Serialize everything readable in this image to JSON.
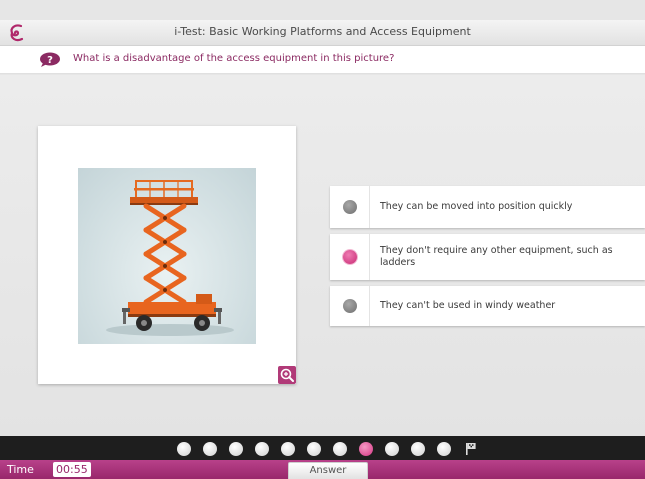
{
  "app": {
    "title": "i-Test: Basic Working Platforms and Access Equipment",
    "logo_icon": "swirl-logo-icon"
  },
  "question": {
    "icon": "question-bubble-icon",
    "text": "What is a disadvantage of the access equipment in this picture?"
  },
  "image": {
    "subject": "scissor-lift",
    "zoom_icon": "zoom-in-icon"
  },
  "options": [
    {
      "text": "They can be moved into position quickly",
      "selected": false
    },
    {
      "text": "They don't require any other equipment, such as ladders",
      "selected": true
    },
    {
      "text": "They can't be used in windy weather",
      "selected": false
    }
  ],
  "progress": {
    "total": 11,
    "current": 8,
    "end_icon": "flag-icon"
  },
  "footer": {
    "time_label": "Time",
    "time_value": "00:55",
    "answer_label": "Answer"
  },
  "colors": {
    "accent": "#98276b",
    "accent_light": "#d63584",
    "question_text": "#8b2a62",
    "progress_bg": "#1e1e1e"
  }
}
